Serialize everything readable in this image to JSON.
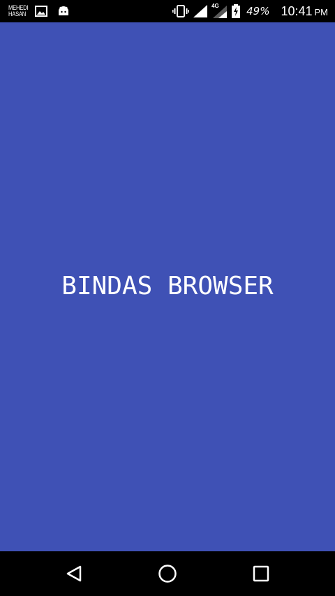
{
  "status_bar": {
    "notification_brand_line1": "MEHEDI",
    "notification_brand_line2": "HASAN",
    "notification_icons": [
      "gallery-icon",
      "android-icon"
    ],
    "system_icons": [
      "vibrate-icon",
      "signal-icon",
      "network-4g-icon",
      "battery-charging-icon"
    ],
    "network_type": "4G",
    "battery_percent": "49%",
    "time": "10:41",
    "ampm": "PM"
  },
  "app": {
    "title": "BINDAS BROWSER",
    "background_color": "#3f51b5"
  },
  "nav_bar": {
    "buttons": [
      "back-icon",
      "home-icon",
      "recents-icon"
    ]
  }
}
